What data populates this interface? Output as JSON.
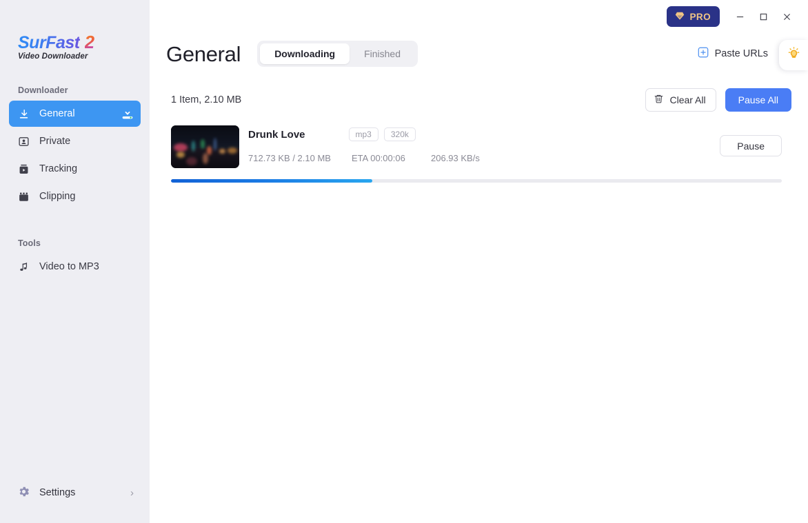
{
  "brand": {
    "name_primary": "SurFast",
    "name_version": "2",
    "tagline": "Video Downloader"
  },
  "sidebar": {
    "section_downloader": "Downloader",
    "section_tools": "Tools",
    "items": [
      {
        "label": "General",
        "icon": "download-arrow-icon",
        "active": true,
        "badge": "download-tray-icon"
      },
      {
        "label": "Private",
        "icon": "private-person-icon",
        "active": false
      },
      {
        "label": "Tracking",
        "icon": "tracking-video-icon",
        "active": false
      },
      {
        "label": "Clipping",
        "icon": "clipping-film-icon",
        "active": false
      }
    ],
    "tools": [
      {
        "label": "Video to MP3",
        "icon": "music-note-icon"
      }
    ],
    "settings": {
      "label": "Settings",
      "icon": "gear-icon",
      "chevron": "›"
    }
  },
  "titlebar": {
    "pro_label": "PRO",
    "pro_icon": "diamond-icon",
    "minimize": "–",
    "maximize": "□",
    "close": "✕"
  },
  "header": {
    "title": "General",
    "tabs": [
      {
        "label": "Downloading",
        "active": true
      },
      {
        "label": "Finished",
        "active": false
      }
    ],
    "paste_urls_label": "Paste URLs",
    "paste_urls_icon": "plus-square-icon",
    "bulb_icon": "lightbulb-icon"
  },
  "toolbar": {
    "item_count": "1 Item, 2.10 MB",
    "clear_all_label": "Clear All",
    "clear_all_icon": "trash-icon",
    "pause_all_label": "Pause All"
  },
  "downloads": [
    {
      "title": "Drunk Love",
      "thumbnail": "night-city-street-thumbnail",
      "badges": [
        "mp3",
        "320k"
      ],
      "size_progress": "712.73 KB / 2.10 MB",
      "eta": "ETA 00:00:06",
      "speed": "206.93 KB/s",
      "progress_percent": 33,
      "action_label": "Pause"
    }
  ],
  "colors": {
    "accent_blue": "#3d96f2",
    "pause_all_blue": "#4a7df5",
    "pro_navy": "#2a3287",
    "pro_gold": "#f0c585",
    "sidebar_bg": "#eeeef3",
    "progress_start": "#1262d6",
    "progress_end": "#29a6ef",
    "bulb_yellow": "#f5b82e"
  }
}
